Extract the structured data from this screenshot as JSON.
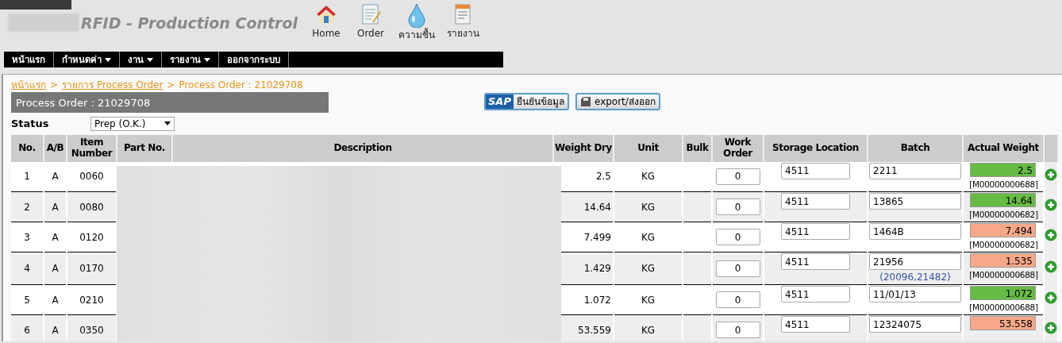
{
  "header": {
    "title": "RFID - Production Control",
    "nav_icons": [
      {
        "kind": "home",
        "label": "Home"
      },
      {
        "kind": "order",
        "label": "Order"
      },
      {
        "kind": "humidity",
        "label": "ความชื้น"
      },
      {
        "kind": "report",
        "label": "รายงาน"
      }
    ]
  },
  "menu": [
    {
      "label": "หน้าแรก",
      "dropdown": false
    },
    {
      "label": "กำหนดค่า",
      "dropdown": true
    },
    {
      "label": "งาน",
      "dropdown": true
    },
    {
      "label": "รายงาน",
      "dropdown": true
    },
    {
      "label": "ออกจากระบบ",
      "dropdown": false
    }
  ],
  "breadcrumb": {
    "separator": ">",
    "items": [
      {
        "label": "หน้าแรก",
        "link": true
      },
      {
        "label": "รายการ Process Order",
        "link": true
      },
      {
        "label": "Process Order : 21029708",
        "link": false
      }
    ]
  },
  "panel_title": "Process Order : 21029708",
  "actions": [
    {
      "kind": "sap",
      "logo_text": "SAP",
      "label": "ยืนยันข้อมูล"
    },
    {
      "kind": "export",
      "label": "export/ส่งออก"
    }
  ],
  "status": {
    "label": "Status",
    "value": "Prep (O.K.)"
  },
  "table": {
    "columns": [
      "No.",
      "A/B",
      "Item Number",
      "Part No.",
      "Description",
      "Weight Dry",
      "Unit",
      "Bulk",
      "Work Order",
      "Storage Location",
      "Batch",
      "Actual Weight"
    ],
    "rows": [
      {
        "no": "1",
        "ab": "A",
        "item_number": "0060",
        "weight_dry": "2.5",
        "unit": "KG",
        "work_order": "0",
        "storage_location": "4511",
        "batch": "2211",
        "actual_weight": "2.5",
        "color": "#66bb44",
        "tag": "[M00000000688]"
      },
      {
        "no": "2",
        "ab": "A",
        "item_number": "0080",
        "weight_dry": "14.64",
        "unit": "KG",
        "work_order": "0",
        "storage_location": "4511",
        "batch": "13865",
        "actual_weight": "14.64",
        "color": "#66bb44",
        "tag": "[M00000000682]"
      },
      {
        "no": "3",
        "ab": "A",
        "item_number": "0120",
        "weight_dry": "7.499",
        "unit": "KG",
        "work_order": "0",
        "storage_location": "4511",
        "batch": "1464B",
        "actual_weight": "7.494",
        "color": "#f8a88a",
        "tag": "[M00000000682]"
      },
      {
        "no": "4",
        "ab": "A",
        "item_number": "0170",
        "weight_dry": "1.429",
        "unit": "KG",
        "work_order": "0",
        "storage_location": "4511",
        "batch": "21956",
        "batch_note": "(20096,21482)",
        "actual_weight": "1.535",
        "color": "#f8a88a",
        "tag": "[M00000000688]"
      },
      {
        "no": "5",
        "ab": "A",
        "item_number": "0210",
        "weight_dry": "1.072",
        "unit": "KG",
        "work_order": "0",
        "storage_location": "4511",
        "batch": "11/01/13",
        "actual_weight": "1.072",
        "color": "#66bb44",
        "tag": "[M00000000688]"
      },
      {
        "no": "6",
        "ab": "A",
        "item_number": "0350",
        "weight_dry": "53.559",
        "unit": "KG",
        "work_order": "0",
        "storage_location": "4511",
        "batch": "12324075",
        "actual_weight": "53.558",
        "color": "#f8a88a"
      }
    ]
  }
}
